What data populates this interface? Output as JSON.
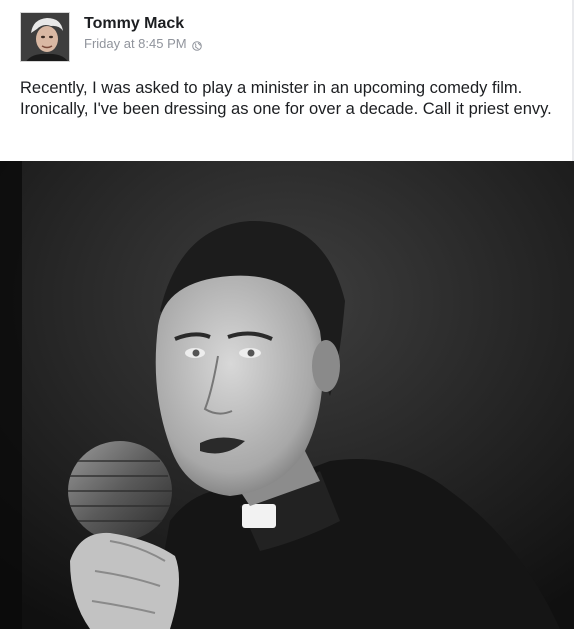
{
  "post": {
    "author": "Tommy Mack",
    "timestamp": "Friday at 8:45 PM",
    "privacy_icon": "globe-icon",
    "text": "Recently, I was asked to play a minister in an upcoming comedy film.  Ironically, I've been dressing as one for over a decade.  Call it priest envy."
  },
  "colors": {
    "author": "#1c1e21",
    "timestamp": "#90949c",
    "text": "#1c1e21"
  }
}
